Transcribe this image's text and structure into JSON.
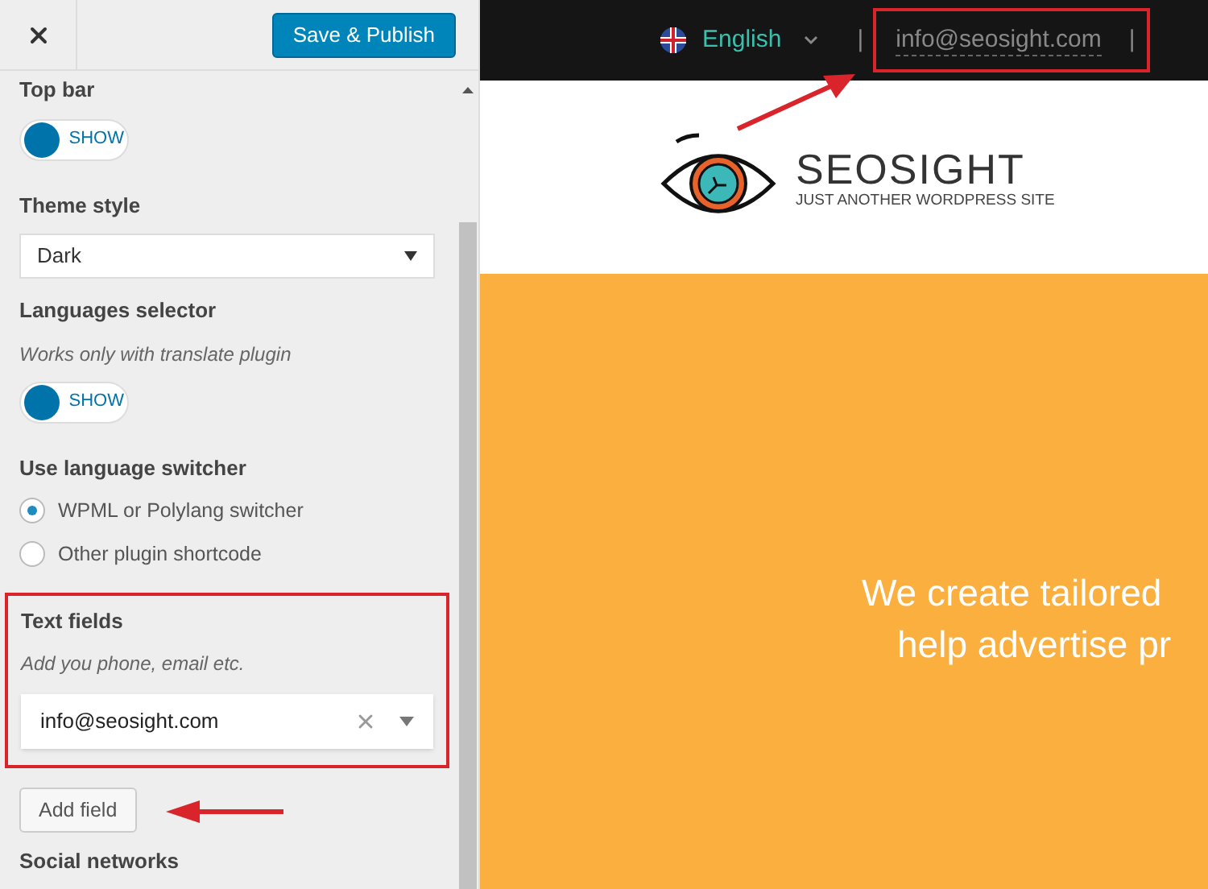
{
  "sidebar": {
    "save_button": "Save & Publish",
    "sections": [
      {
        "kind": "toggle",
        "label": "Top bar",
        "toggle": {
          "text": "SHOW"
        }
      },
      {
        "kind": "select",
        "label": "Theme style",
        "value": "Dark"
      },
      {
        "kind": "toggle",
        "label": "Languages selector",
        "hint": "Works only with translate plugin",
        "toggle": {
          "text": "SHOW"
        }
      },
      {
        "kind": "radio",
        "label": "Use language switcher",
        "options": [
          {
            "label": "WPML or Polylang switcher",
            "selected": true
          },
          {
            "label": "Other plugin shortcode",
            "selected": false
          }
        ]
      },
      {
        "kind": "textfields",
        "label": "Text fields",
        "hint": "Add you phone, email etc.",
        "value": "info@seosight.com",
        "highlighted": true
      },
      {
        "kind": "button",
        "label": "Add field"
      },
      {
        "kind": "heading",
        "label": "Social networks"
      }
    ]
  },
  "preview": {
    "language": "English",
    "separator_left": "|",
    "email": "info@seosight.com",
    "separator_right": "|",
    "email_highlighted": true,
    "logo": {
      "title": "SEOSIGHT",
      "tagline": "JUST ANOTHER WORDPRESS SITE"
    },
    "hero_lines": [
      "We create tailored",
      "help advertise pr"
    ]
  }
}
